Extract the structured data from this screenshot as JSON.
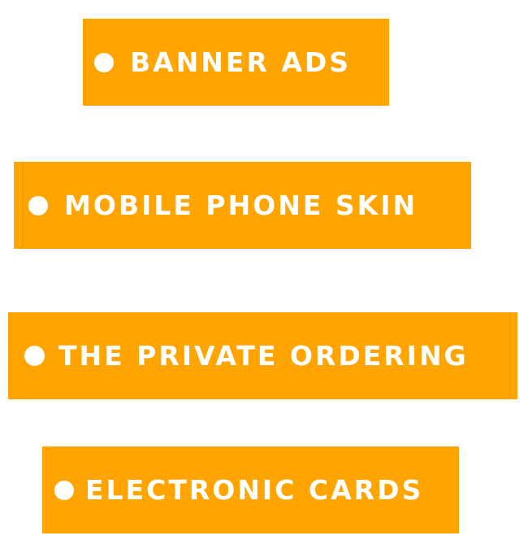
{
  "tags": [
    {
      "label": "BANNER ADS"
    },
    {
      "label": "MOBILE PHONE SKIN"
    },
    {
      "label": "THE PRIVATE ORDERING"
    },
    {
      "label": "ELECTRONIC CARDS"
    }
  ],
  "colors": {
    "tag_background": "#ffa400",
    "text": "#ffffff",
    "page_background": "#ffffff"
  }
}
